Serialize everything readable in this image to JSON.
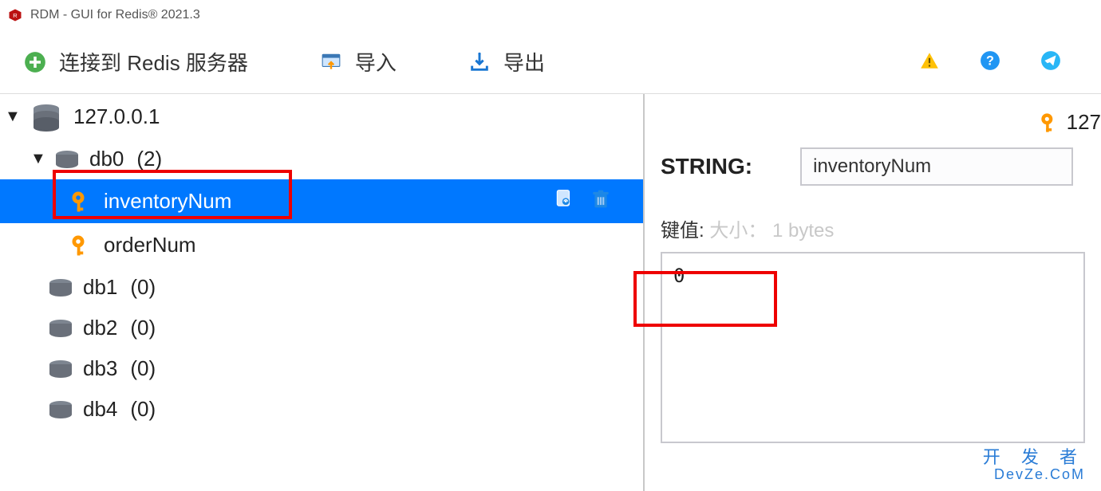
{
  "window": {
    "title": "RDM - GUI for Redis® 2021.3"
  },
  "toolbar": {
    "connect_label": "连接到 Redis 服务器",
    "import_label": "导入",
    "export_label": "导出"
  },
  "tree": {
    "server": {
      "host": "127.0.0.1",
      "expanded": true
    },
    "db0": {
      "label": "db0",
      "count": "(2)",
      "expanded": true
    },
    "keys": [
      {
        "name": "inventoryNum",
        "selected": true
      },
      {
        "name": "orderNum",
        "selected": false
      }
    ],
    "empty_dbs": [
      {
        "label": "db1",
        "count": "(0)"
      },
      {
        "label": "db2",
        "count": "(0)"
      },
      {
        "label": "db3",
        "count": "(0)"
      },
      {
        "label": "db4",
        "count": "(0)"
      }
    ]
  },
  "detail": {
    "breadcrumb_host": "127",
    "type_label": "STRING:",
    "key_name": "inventoryNum",
    "value_label": "键值:",
    "size_label": "大小：",
    "size_value": "1 bytes",
    "value": "0"
  },
  "watermark": {
    "line1": "开 发 者",
    "line2": "DevZe.CoM"
  },
  "colors": {
    "selection": "#0078ff",
    "key_icon": "#ff9800",
    "highlight": "#ee0000"
  }
}
